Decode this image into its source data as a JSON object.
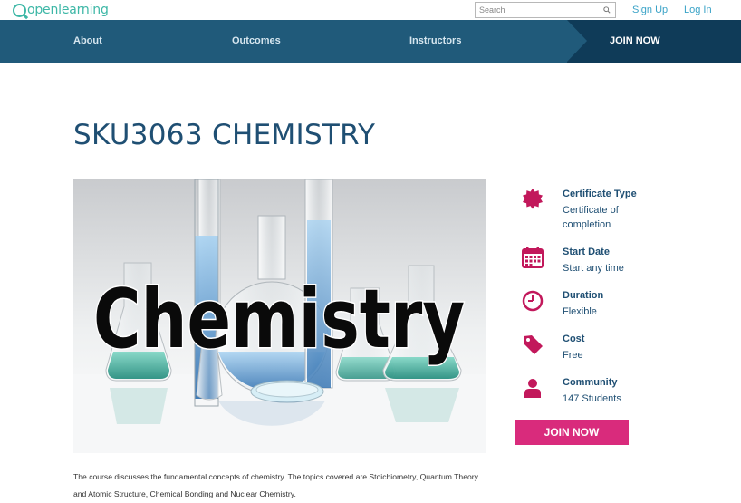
{
  "brand": {
    "name": "openlearning"
  },
  "search": {
    "placeholder": "Search"
  },
  "top_links": {
    "signup": "Sign Up",
    "login": "Log In"
  },
  "nav": {
    "about": "About",
    "outcomes": "Outcomes",
    "instructors": "Instructors",
    "join": "JOIN NOW"
  },
  "course": {
    "title": "SKU3063 CHEMISTRY",
    "image_text": "Chemistry",
    "description": "The course discusses the fundamental concepts of chemistry. The topics covered are Stoichiometry, Quantum Theory and Atomic Structure, Chemical Bonding and Nuclear Chemistry."
  },
  "info": [
    {
      "icon": "certificate-icon",
      "label": "Certificate Type",
      "value": "Certificate of completion"
    },
    {
      "icon": "calendar-icon",
      "label": "Start Date",
      "value": "Start any time"
    },
    {
      "icon": "clock-icon",
      "label": "Duration",
      "value": "Flexible"
    },
    {
      "icon": "price-tag-icon",
      "label": "Cost",
      "value": "Free"
    },
    {
      "icon": "person-icon",
      "label": "Community",
      "value": "147 Students"
    }
  ],
  "join_button": "JOIN NOW",
  "colors": {
    "accent": "#d92b7c",
    "nav": "#205a7a",
    "nav_dark": "#0f3b58",
    "brand": "#3db7a6",
    "title": "#1f4f73"
  }
}
